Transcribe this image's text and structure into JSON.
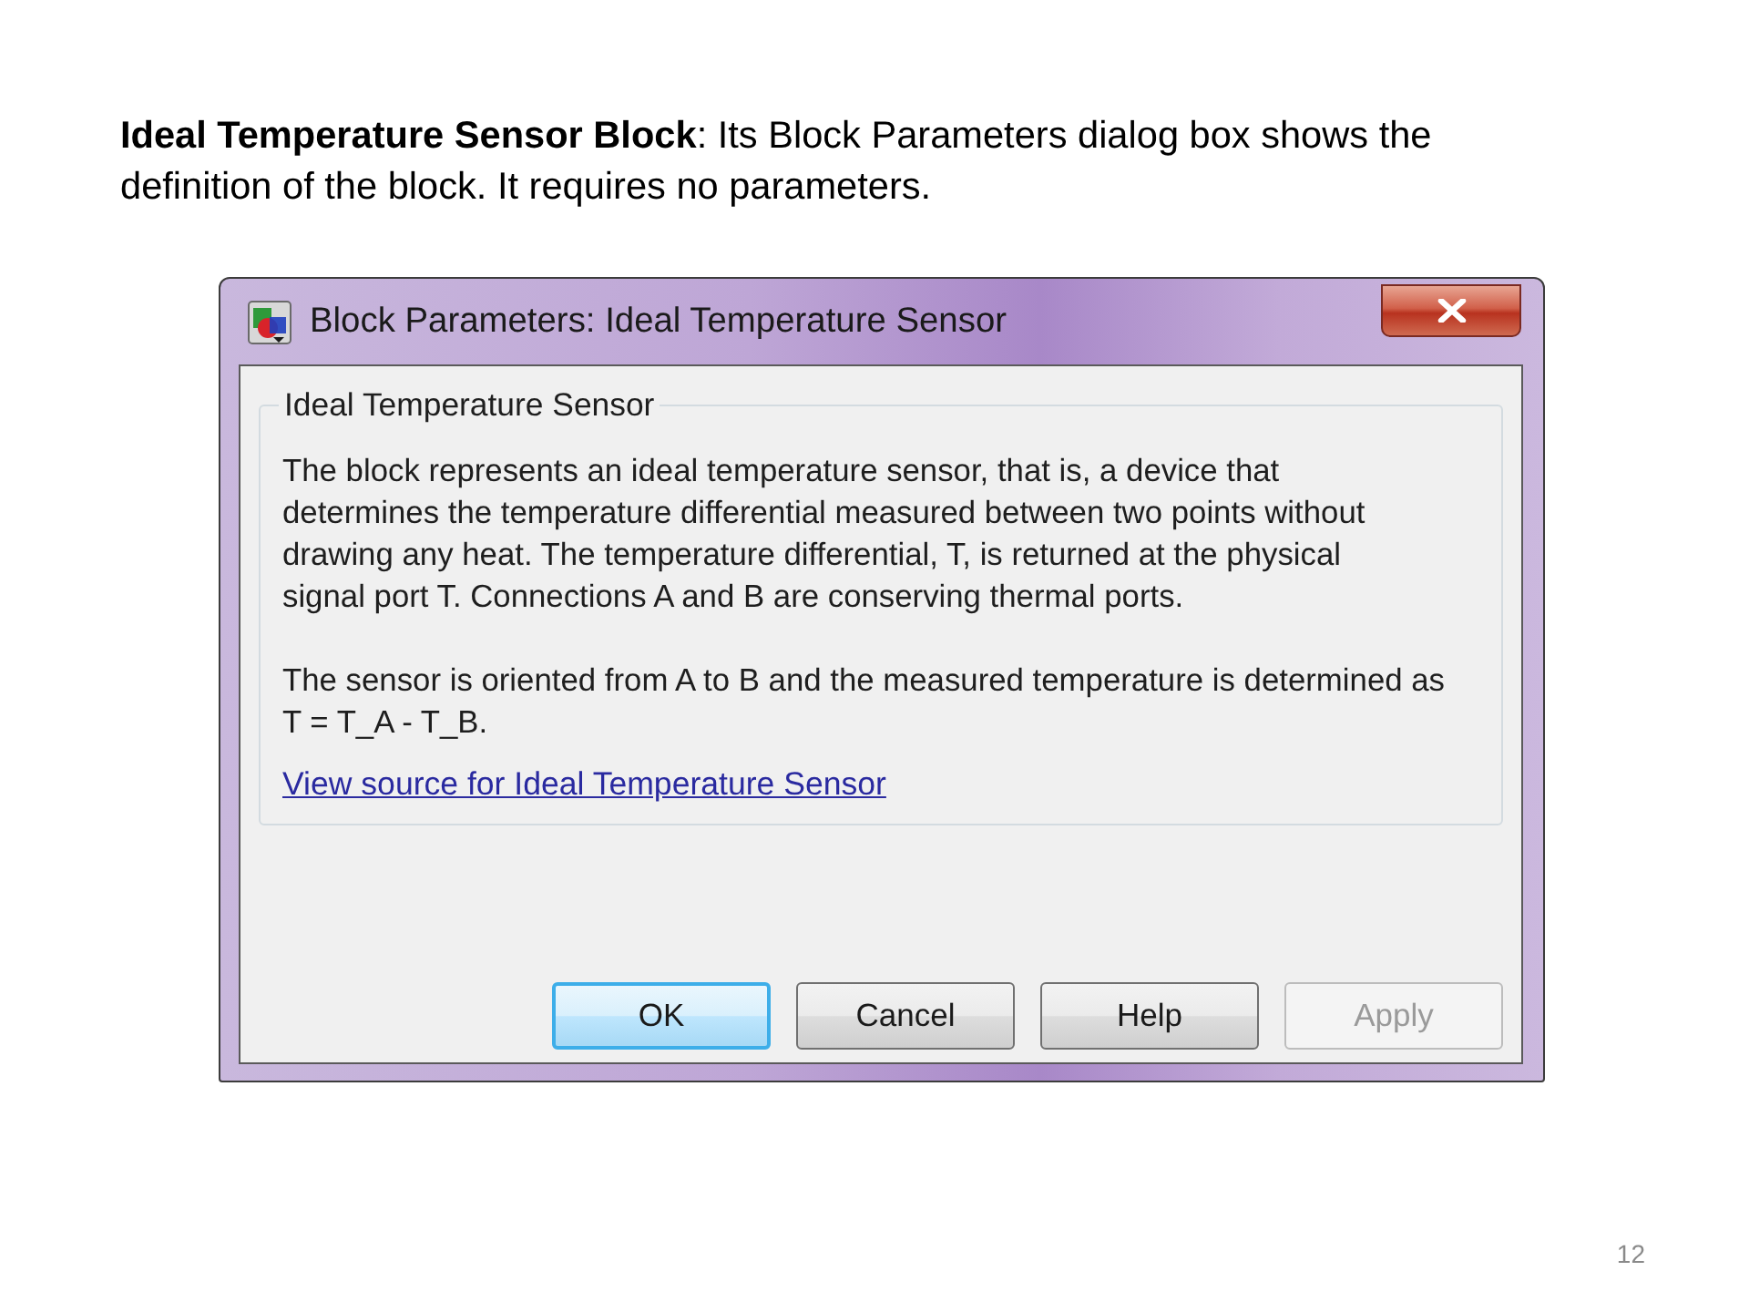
{
  "caption": {
    "text": "**Ideal Temperature Sensor Block**: Its Block Parameters dialog box shows the\ndefinition of the block. It requires no parameters."
  },
  "dialog": {
    "title": "Block Parameters: Ideal Temperature Sensor",
    "group": {
      "title": "Ideal Temperature Sensor",
      "paragraphs": [
        "The block represents an ideal temperature sensor, that is, a device that\ndetermines the temperature differential measured between two points without\ndrawing any heat. The temperature differential, T, is returned at the physical\nsignal port T. Connections A and B are conserving thermal ports.",
        "The sensor is oriented from A to B and the measured temperature is determined as\nT = T_A - T_B."
      ],
      "link": "View source for Ideal Temperature Sensor"
    },
    "buttons": [
      {
        "label": "OK",
        "default": true,
        "disabled": false
      },
      {
        "label": "Cancel",
        "default": false,
        "disabled": false
      },
      {
        "label": "Help",
        "default": false,
        "disabled": false
      },
      {
        "label": "Apply",
        "default": false,
        "disabled": true
      }
    ]
  },
  "page_number": "12"
}
